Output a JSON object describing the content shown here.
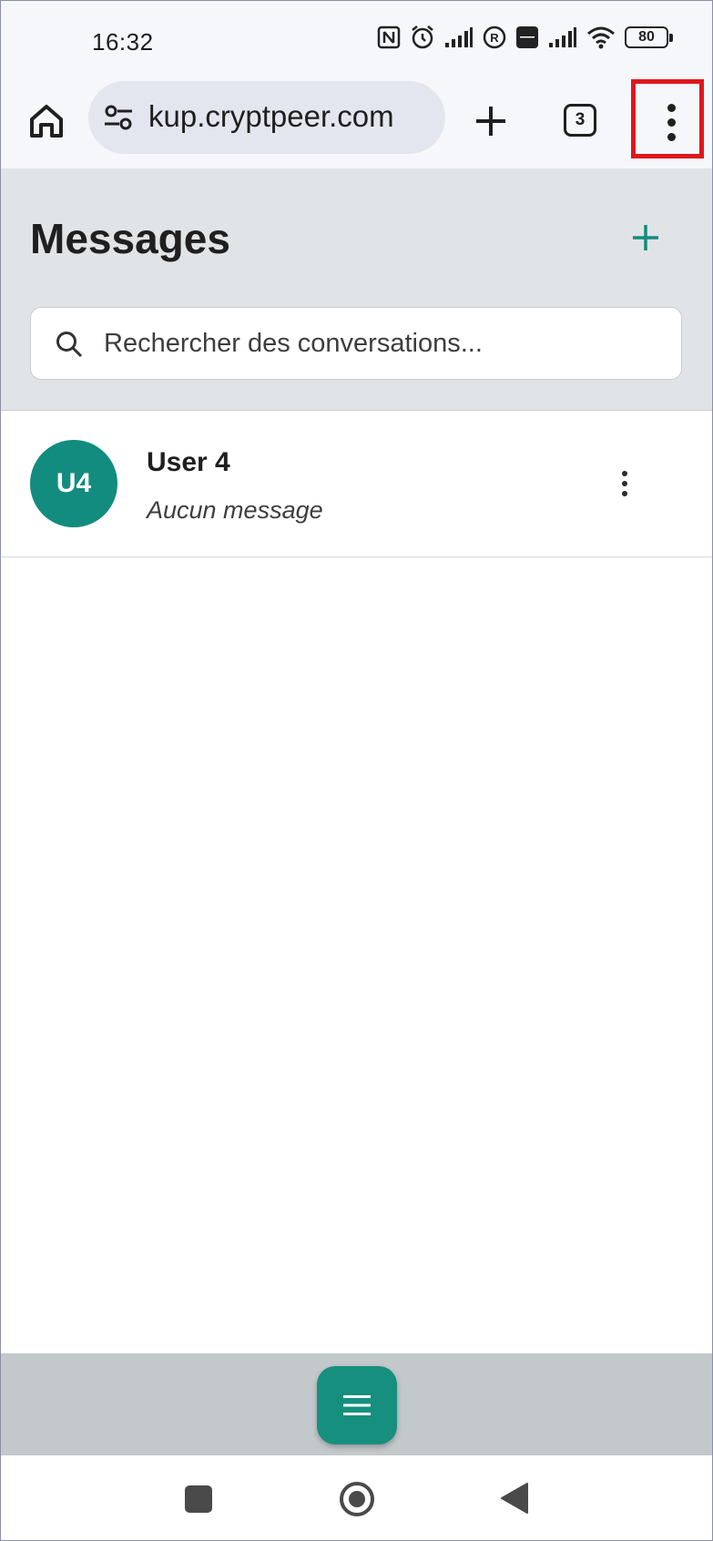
{
  "status_bar": {
    "time": "16:32",
    "battery": "80",
    "icons": [
      "nfc-icon",
      "alarm-icon",
      "signal-icon",
      "roaming-icon",
      "volte-icon",
      "signal-icon",
      "wifi-icon",
      "battery-icon"
    ]
  },
  "browser": {
    "url": "kup.cryptpeer.com",
    "tab_count": "3",
    "icons": [
      "home-icon",
      "site-settings-icon",
      "new-tab-icon",
      "tabs-icon",
      "more-vert-icon"
    ],
    "highlight_color": "#e0161d"
  },
  "messages": {
    "title": "Messages",
    "search_placeholder": "Rechercher des conversations...",
    "accent": "#128c7e"
  },
  "conversations": [
    {
      "avatar": "U4",
      "name": "User 4",
      "preview": "Aucun message"
    }
  ],
  "bottom_bar": {
    "fab_icon": "menu-icon"
  },
  "nav_bar": {
    "icons": [
      "recents-icon",
      "home-circle-icon",
      "back-icon"
    ]
  }
}
